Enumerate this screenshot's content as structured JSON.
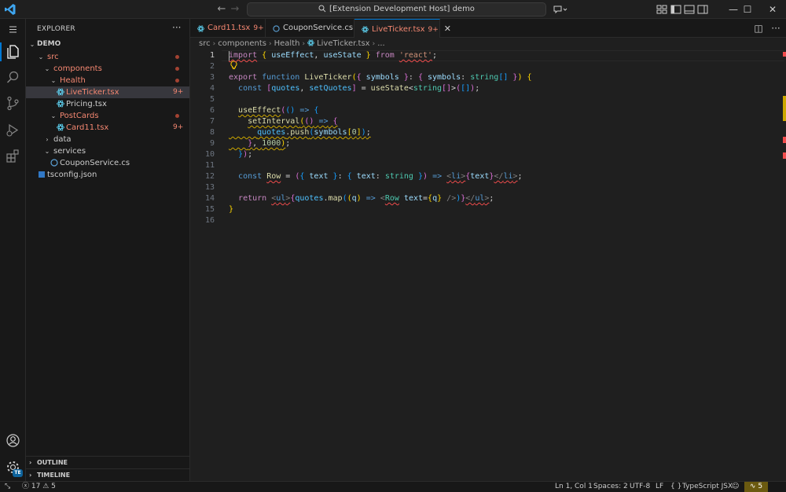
{
  "titlebar": {
    "search_text": "[Extension Development Host] demo"
  },
  "sidebar": {
    "title": "EXPLORER",
    "root": "DEMO",
    "tree": [
      {
        "label": "src",
        "type": "folder",
        "open": true,
        "depth": 1,
        "error": true,
        "dot": true
      },
      {
        "label": "components",
        "type": "folder",
        "open": true,
        "depth": 2,
        "error": true,
        "dot": true
      },
      {
        "label": "Health",
        "type": "folder",
        "open": true,
        "depth": 3,
        "error": true,
        "dot": true
      },
      {
        "label": "LiveTicker.tsx",
        "type": "react",
        "depth": 4,
        "error": true,
        "badge": "9+",
        "selected": true
      },
      {
        "label": "Pricing.tsx",
        "type": "react",
        "depth": 4,
        "error": false
      },
      {
        "label": "PostCards",
        "type": "folder",
        "open": true,
        "depth": 3,
        "error": true,
        "dot": true
      },
      {
        "label": "Card11.tsx",
        "type": "react",
        "depth": 4,
        "error": true,
        "badge": "9+"
      },
      {
        "label": "data",
        "type": "folder",
        "open": false,
        "depth": 2,
        "error": false
      },
      {
        "label": "services",
        "type": "folder",
        "open": true,
        "depth": 2,
        "error": false
      },
      {
        "label": "CouponService.cs",
        "type": "csharp",
        "depth": 3,
        "error": false
      },
      {
        "label": "tsconfig.json",
        "type": "tsconfig",
        "depth": 1,
        "error": false
      }
    ],
    "outline": "OUTLINE",
    "timeline": "TIMELINE"
  },
  "tabs": [
    {
      "label": "Card11.tsx",
      "badge": "9+",
      "error": true,
      "active": false
    },
    {
      "label": "CouponService.cs",
      "badge": "",
      "error": false,
      "active": false
    },
    {
      "label": "LiveTicker.tsx",
      "badge": "9+",
      "error": true,
      "active": true
    }
  ],
  "breadcrumb": [
    "src",
    "components",
    "Health",
    "LiveTicker.tsx",
    "..."
  ],
  "editor": {
    "line_numbers": [
      "1",
      "2",
      "3",
      "4",
      "5",
      "6",
      "7",
      "8",
      "9",
      "10",
      "11",
      "12",
      "13",
      "14",
      "15",
      "16"
    ],
    "current_line": "1"
  },
  "statusbar": {
    "errors": "17",
    "warnings": "5",
    "position": "Ln 1, Col 1",
    "spaces": "Spaces: 2",
    "encoding": "UTF-8",
    "eol": "LF",
    "language": "TypeScript JSX",
    "notifications": "5"
  },
  "colors": {
    "accent": "#0078d4",
    "error": "#f48771",
    "warning_bg": "#6b5a10"
  }
}
